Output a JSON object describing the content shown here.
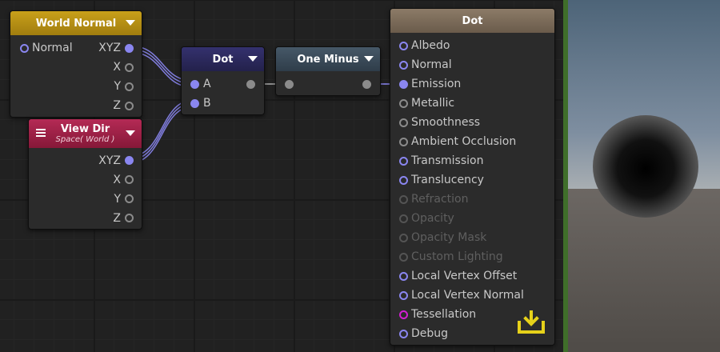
{
  "nodes": {
    "world_normal": {
      "title": "World Normal",
      "inputs": [
        "Normal"
      ],
      "outputs": [
        "XYZ",
        "X",
        "Y",
        "Z"
      ],
      "header_color": "#b08a12"
    },
    "view_dir": {
      "title": "View Dir",
      "subtitle": "Space( World )",
      "outputs": [
        "XYZ",
        "X",
        "Y",
        "Z"
      ],
      "header_color": "#9b1f45"
    },
    "dot_small": {
      "title": "Dot",
      "inputs": [
        "A",
        "B"
      ],
      "header_color": "#2b2a5e"
    },
    "one_minus": {
      "title": "One Minus",
      "header_color": "#3b4b5a"
    },
    "output_dot": {
      "title": "Dot",
      "header_color": "#7a6a58",
      "inputs": [
        {
          "label": "Albedo",
          "state": "active"
        },
        {
          "label": "Normal",
          "state": "active"
        },
        {
          "label": "Emission",
          "state": "connected"
        },
        {
          "label": "Metallic",
          "state": "inactive"
        },
        {
          "label": "Smoothness",
          "state": "inactive"
        },
        {
          "label": "Ambient Occlusion",
          "state": "inactive"
        },
        {
          "label": "Transmission",
          "state": "active"
        },
        {
          "label": "Translucency",
          "state": "active"
        },
        {
          "label": "Refraction",
          "state": "disabled"
        },
        {
          "label": "Opacity",
          "state": "disabled"
        },
        {
          "label": "Opacity Mask",
          "state": "disabled"
        },
        {
          "label": "Custom Lighting",
          "state": "disabled"
        },
        {
          "label": "Local Vertex Offset",
          "state": "active"
        },
        {
          "label": "Local Vertex Normal",
          "state": "active"
        },
        {
          "label": "Tessellation",
          "state": "tessellation"
        },
        {
          "label": "Debug",
          "state": "active"
        }
      ]
    }
  },
  "icons": {
    "dropdown": "triangle-down",
    "hamburger": "hamburger-menu",
    "master": "download-tray"
  },
  "colors": {
    "port_active": "#8a86f0",
    "port_inactive": "#8b8b8b",
    "port_tessellation": "#d21fd2",
    "wire": "#8a86f0",
    "master_icon": "#e6d11a"
  }
}
